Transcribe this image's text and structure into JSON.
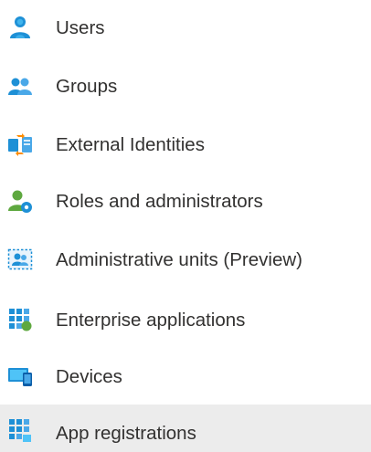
{
  "nav": {
    "items": [
      {
        "label": "Users",
        "icon": "user-icon",
        "selected": false
      },
      {
        "label": "Groups",
        "icon": "groups-icon",
        "selected": false
      },
      {
        "label": "External Identities",
        "icon": "external-identities-icon",
        "selected": false
      },
      {
        "label": "Roles and administrators",
        "icon": "roles-icon",
        "selected": false
      },
      {
        "label": "Administrative units (Preview)",
        "icon": "admin-units-icon",
        "selected": false
      },
      {
        "label": "Enterprise applications",
        "icon": "enterprise-apps-icon",
        "selected": false
      },
      {
        "label": "Devices",
        "icon": "devices-icon",
        "selected": false
      },
      {
        "label": "App registrations",
        "icon": "app-registrations-icon",
        "selected": true
      }
    ]
  },
  "colors": {
    "selected_background": "#ececec",
    "text": "#323130",
    "icon_blue": "#0078d4",
    "icon_light_blue": "#50e6ff",
    "icon_green": "#5ea83f",
    "icon_orange": "#ff8c00"
  }
}
